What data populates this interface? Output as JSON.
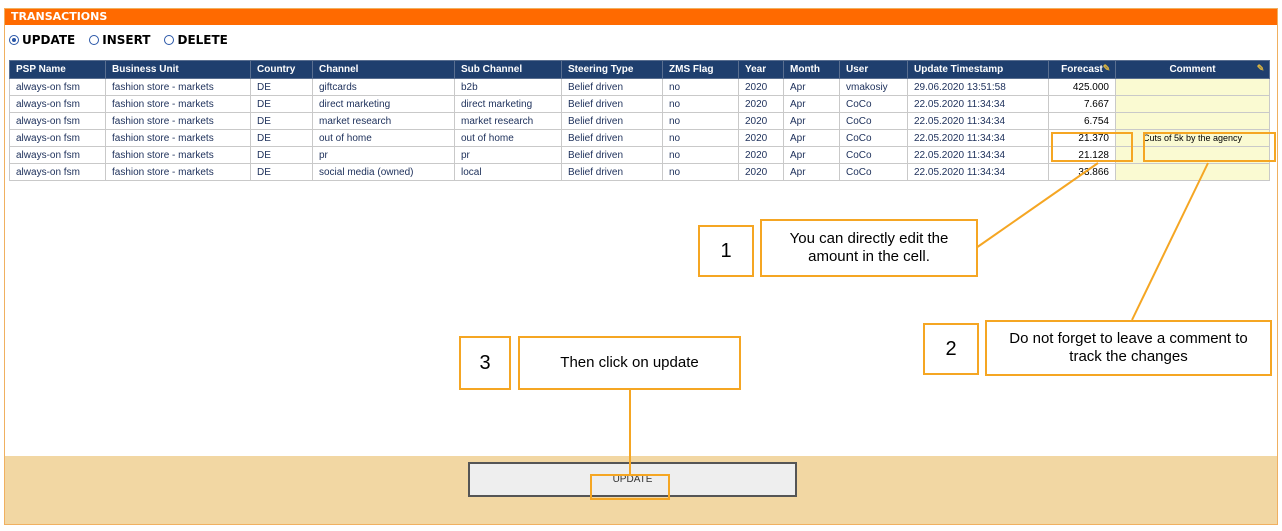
{
  "window": {
    "title": "TRANSACTIONS"
  },
  "modes": [
    {
      "label": "UPDATE",
      "selected": true
    },
    {
      "label": "INSERT",
      "selected": false
    },
    {
      "label": "DELETE",
      "selected": false
    }
  ],
  "table": {
    "headers": [
      "PSP Name",
      "Business Unit",
      "Country",
      "Channel",
      "Sub Channel",
      "Steering Type",
      "ZMS Flag",
      "Year",
      "Month",
      "User",
      "Update Timestamp",
      "Forecast",
      "Comment"
    ],
    "rows": [
      [
        "always-on fsm",
        "fashion store - markets",
        "DE",
        "giftcards",
        "b2b",
        "Belief driven",
        "no",
        "2020",
        "Apr",
        "vmakosiy",
        "29.06.2020 13:51:58",
        "425.000",
        ""
      ],
      [
        "always-on fsm",
        "fashion store - markets",
        "DE",
        "direct marketing",
        "direct marketing",
        "Belief driven",
        "no",
        "2020",
        "Apr",
        "CoCo",
        "22.05.2020 11:34:34",
        "7.667",
        ""
      ],
      [
        "always-on fsm",
        "fashion store - markets",
        "DE",
        "market research",
        "market research",
        "Belief driven",
        "no",
        "2020",
        "Apr",
        "CoCo",
        "22.05.2020 11:34:34",
        "6.754",
        ""
      ],
      [
        "always-on fsm",
        "fashion store - markets",
        "DE",
        "out of home",
        "out of home",
        "Belief driven",
        "no",
        "2020",
        "Apr",
        "CoCo",
        "22.05.2020 11:34:34",
        "21.370",
        "Cuts of 5k by the agency"
      ],
      [
        "always-on fsm",
        "fashion store - markets",
        "DE",
        "pr",
        "pr",
        "Belief driven",
        "no",
        "2020",
        "Apr",
        "CoCo",
        "22.05.2020 11:34:34",
        "21.128",
        ""
      ],
      [
        "always-on fsm",
        "fashion store - markets",
        "DE",
        "social media (owned)",
        "local",
        "Belief driven",
        "no",
        "2020",
        "Apr",
        "CoCo",
        "22.05.2020 11:34:34",
        "33.866",
        ""
      ]
    ]
  },
  "update_button": {
    "label": "UPDATE"
  },
  "annotations": [
    {
      "number": "1",
      "text": "You can directly edit the amount in the cell."
    },
    {
      "number": "2",
      "text": "Do not forget to leave a comment to track the changes"
    },
    {
      "number": "3",
      "text": "Then click on update"
    }
  ],
  "colors": {
    "title_bar": "#ff6a00",
    "header": "#1f3f6e",
    "annotation": "#f5a623",
    "bottom_band": "#f2d7a3",
    "comment_cell": "#fafad2"
  },
  "icons": {
    "radio": "radio-button-icon",
    "edit": "pencil-icon"
  }
}
